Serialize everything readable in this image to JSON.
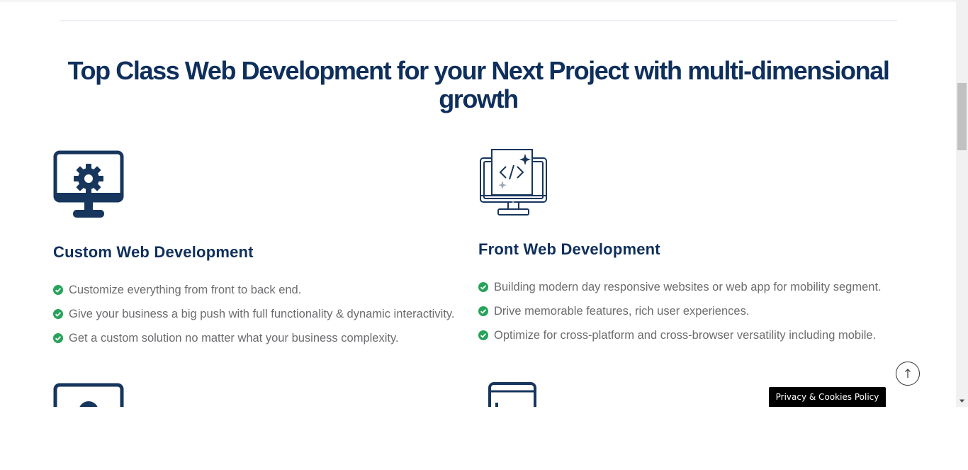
{
  "section": {
    "heading": "Top Class Web Development for your Next Project with multi-dimensional growth"
  },
  "services": [
    {
      "icon": "monitor-gear-icon",
      "title": "Custom Web Development",
      "features": [
        "Customize everything from front to back end.",
        "Give your business a big push with full functionality & dynamic interactivity.",
        "Get a custom solution no matter what your business complexity."
      ]
    },
    {
      "icon": "monitor-code-icon",
      "title": "Front Web Development",
      "features": [
        "Building modern day responsive websites or web app for mobility segment.",
        "Drive memorable features, rich user experiences.",
        "Optimize for cross-platform and cross-browser versatility including mobile."
      ]
    }
  ],
  "bottom_icons": [
    "monitor-icon",
    "tablet-icon"
  ],
  "privacy_badge": "Privacy & Cookies Policy",
  "scroll_top_icon": "arrow-up-icon",
  "colors": {
    "heading": "#0f2f5c",
    "icon": "#17365d",
    "check": "#27a35a",
    "text": "#6c6c70"
  }
}
